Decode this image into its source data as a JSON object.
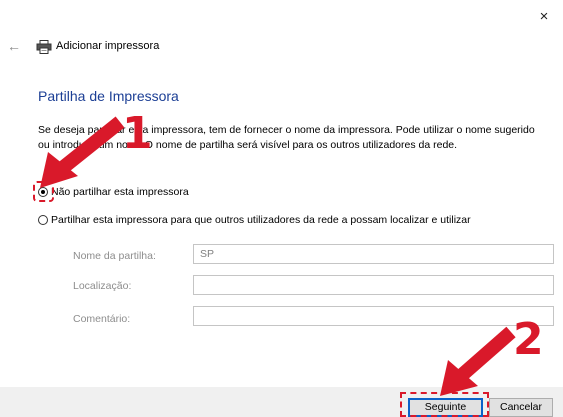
{
  "window": {
    "title": "Adicionar impressora",
    "back_icon": "←",
    "close_icon": "×"
  },
  "page": {
    "heading": "Partilha de Impressora",
    "description_line1": "Se deseja partilhar esta impressora, tem de fornecer o nome da impressora. Pode utilizar o nome sugerido",
    "description_line2": "ou introduzir um novo. O nome de partilha será visível para os outros utilizadores da rede."
  },
  "options": {
    "no_share_label": "Não partilhar esta impressora",
    "share_label": "Partilhar esta impressora para que outros utilizadores da rede a possam localizar e utilizar",
    "selected": "no_share"
  },
  "fields": {
    "share_name_label": "Nome da partilha:",
    "share_name_value": "SP",
    "location_label": "Localização:",
    "location_value": "",
    "comment_label": "Comentário:",
    "comment_value": ""
  },
  "buttons": {
    "next_label": "Seguinte",
    "cancel_label": "Cancelar"
  },
  "annotations": {
    "step1": "1",
    "step2": "2",
    "color": "#d9192a"
  }
}
